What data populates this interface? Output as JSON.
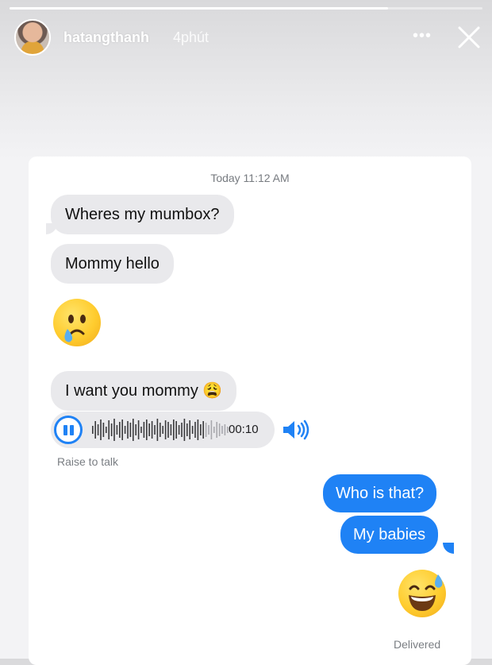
{
  "story": {
    "username": "hatangthanh",
    "time_ago": "4phút",
    "progress": 0.8,
    "more_icon": "ellipsis-icon",
    "close_icon": "close-icon"
  },
  "chat": {
    "timestamp": "Today 11:12 AM",
    "incoming": [
      "Wheres my mumbox?",
      "Mommy hello",
      "😢",
      "I want you mommy 😩"
    ],
    "audio": {
      "duration": "00:10",
      "state": "playing",
      "hint": "Raise to talk"
    },
    "outgoing": [
      "Who is that?",
      "My babies",
      "😅"
    ],
    "status": "Delivered"
  },
  "colors": {
    "outgoing_bubble": "#1f82f5",
    "incoming_bubble": "#e9e9ec",
    "accent": "#1f82f5"
  }
}
